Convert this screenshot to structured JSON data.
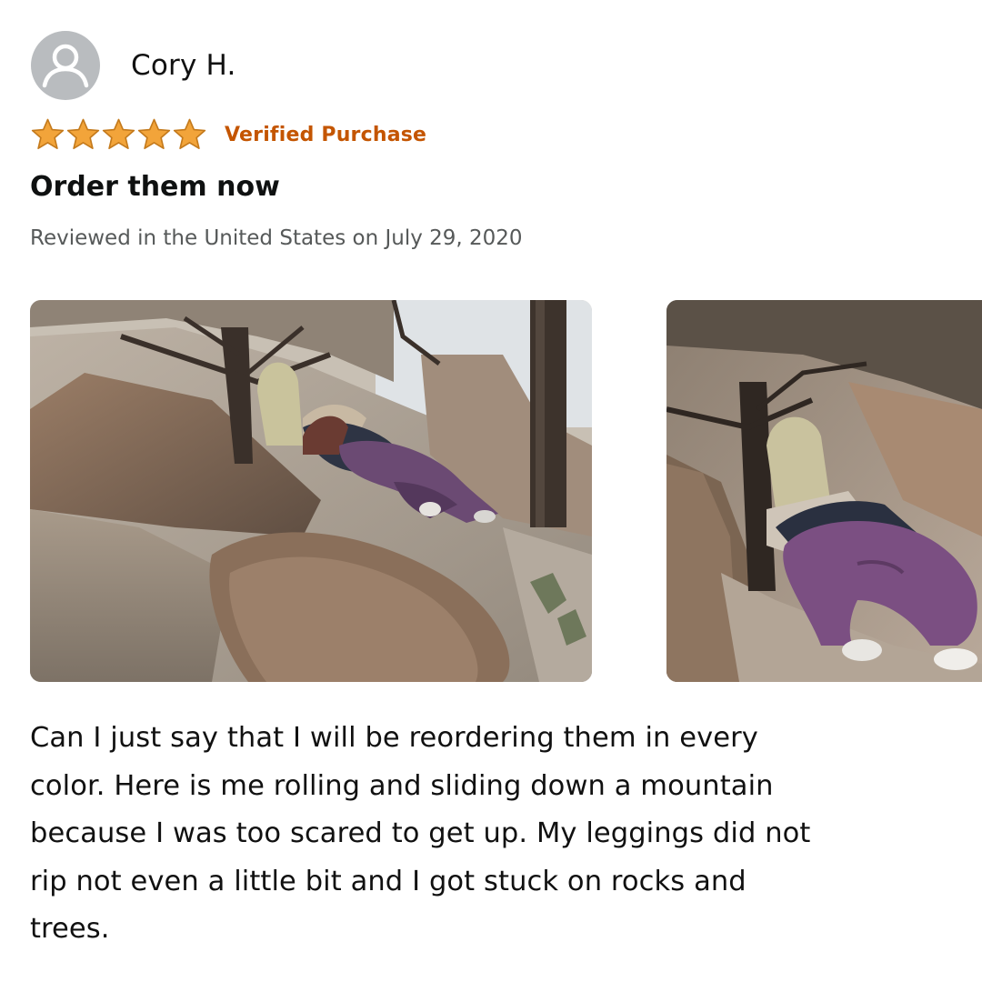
{
  "review": {
    "reviewer": {
      "name": "Cory H.",
      "avatar_icon": "user-silhouette-icon"
    },
    "rating": {
      "stars": 5,
      "max_stars": 5,
      "star_color": "#f2a43a",
      "star_icon": "star-icon"
    },
    "badge": {
      "label": "Verified Purchase",
      "color": "#c45500"
    },
    "title": "Order them now",
    "date_line": "Reviewed in the United States on July 29, 2020",
    "images": [
      {
        "subject": "photo-woman-lying-on-rocky-slope-wide"
      },
      {
        "subject": "photo-woman-lying-on-rocky-slope-closeup"
      }
    ],
    "body_lines": [
      "Can I just say that I will be reordering them in every",
      "color. Here is me rolling and sliding down a mountain",
      "because I was too scared to get up. My leggings did not",
      "rip not even a little bit and I got stuck on rocks and",
      "trees."
    ]
  }
}
